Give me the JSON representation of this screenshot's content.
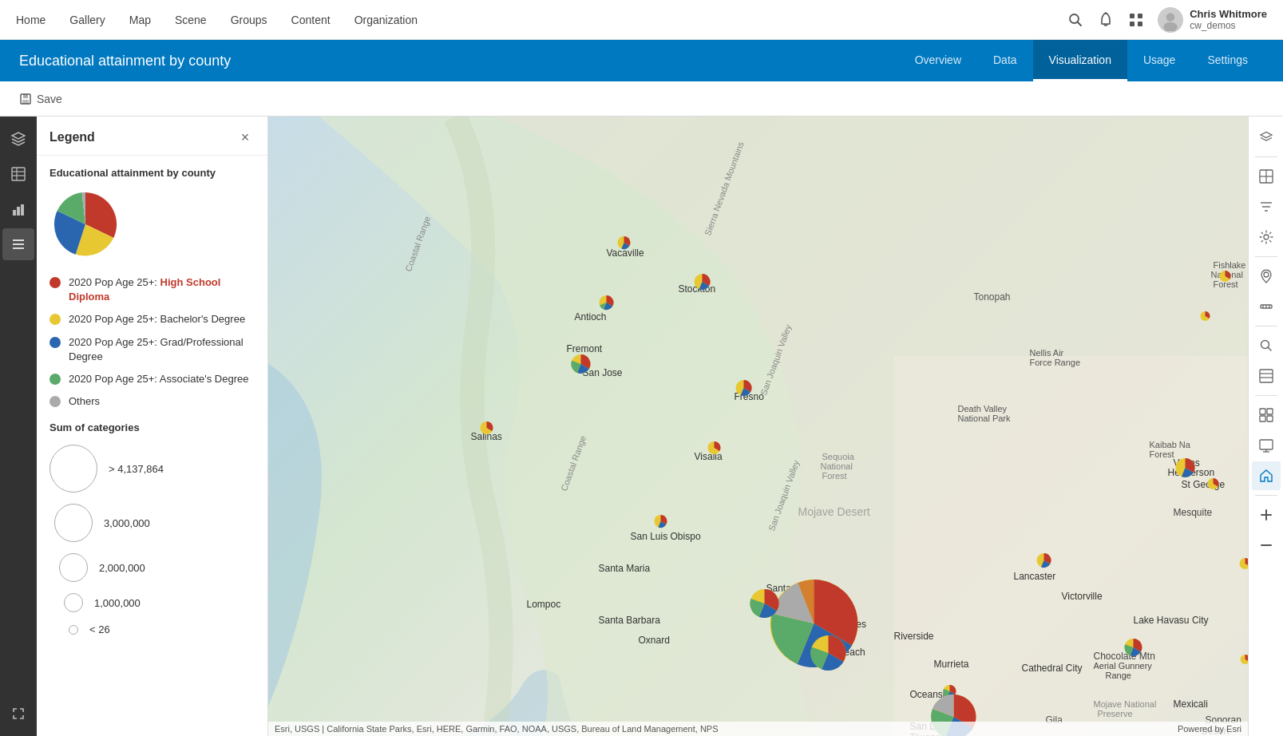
{
  "topNav": {
    "links": [
      "Home",
      "Gallery",
      "Map",
      "Scene",
      "Groups",
      "Content",
      "Organization"
    ],
    "user": {
      "name": "Chris Whitmore",
      "handle": "cw_demos"
    }
  },
  "blueHeader": {
    "title": "Educational attainment by county",
    "tabs": [
      "Overview",
      "Data",
      "Visualization",
      "Usage",
      "Settings"
    ],
    "activeTab": "Visualization"
  },
  "toolbar": {
    "saveLabel": "Save"
  },
  "legend": {
    "title": "Legend",
    "sectionTitle": "Educational attainment by county",
    "items": [
      {
        "color": "#c0392b",
        "label": "2020 Pop Age 25+: ",
        "labelBold": "High School Diploma"
      },
      {
        "color": "#e8c832",
        "label": "2020 Pop Age 25+: ",
        "labelBold": "Bachelor's Degree"
      },
      {
        "color": "#2a66b0",
        "label": "2020 Pop Age 25+: ",
        "labelBold": "Grad/Professional Degree"
      },
      {
        "color": "#5aaa6a",
        "label": "2020 Pop Age 25+: ",
        "labelBold": "Associate's Degree"
      },
      {
        "color": "#aaaaaa",
        "label": "Others",
        "labelBold": ""
      }
    ],
    "sumTitle": "Sum of categories",
    "sumItems": [
      {
        "size": 60,
        "label": "> 4,137,864"
      },
      {
        "size": 48,
        "label": "3,000,000"
      },
      {
        "size": 36,
        "label": "2,000,000"
      },
      {
        "size": 24,
        "label": "1,000,000"
      },
      {
        "size": 12,
        "label": "< 26"
      }
    ]
  },
  "mapAttribution": {
    "left": "Esri, USGS | California State Parks, Esri, HERE, Garmin, FAO, NOAA, USGS, Bureau of Land Management, NPS",
    "right": "Powered by Esri"
  },
  "rightSidebarIcons": [
    "layers",
    "table",
    "filter",
    "settings",
    "location",
    "analysis",
    "zoom-in",
    "grid",
    "screen",
    "home",
    "zoom-plus",
    "zoom-minus"
  ]
}
